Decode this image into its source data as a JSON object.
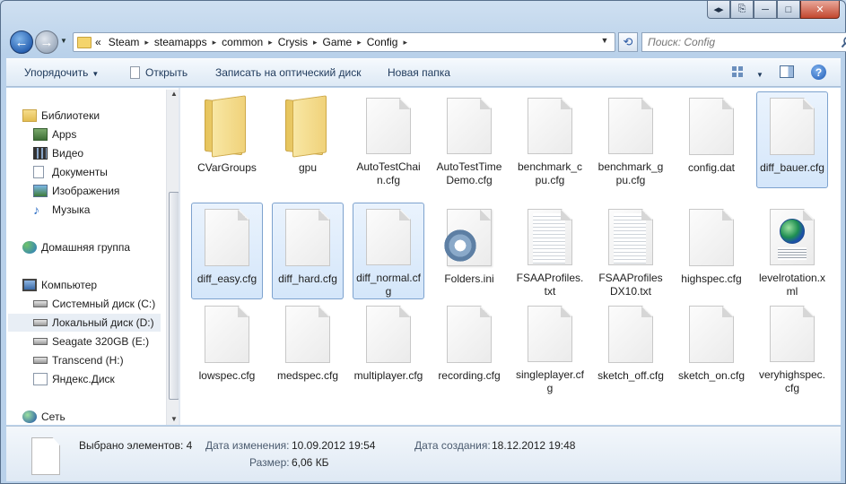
{
  "window": {
    "caption_buttons": [
      "◂▸",
      "⎘",
      "─",
      "□",
      "✕"
    ]
  },
  "nav": {
    "crumbs": [
      "Steam",
      "steamapps",
      "common",
      "Crysis",
      "Game",
      "Config"
    ],
    "overflow": "«",
    "search_placeholder": "Поиск: Config"
  },
  "toolbar": {
    "organize": "Упорядочить",
    "open": "Открыть",
    "burn": "Записать на оптический диск",
    "new_folder": "Новая папка"
  },
  "sidebar": {
    "libraries": "Библиотеки",
    "apps": "Apps",
    "video": "Видео",
    "documents": "Документы",
    "images": "Изображения",
    "music": "Музыка",
    "homegroup": "Домашняя группа",
    "computer": "Компьютер",
    "drive_c": "Системный диск (C:)",
    "drive_d": "Локальный диск (D:)",
    "drive_e": "Seagate 320GB (E:)",
    "drive_h": "Transcend (H:)",
    "yandex": "Яндекс.Диск",
    "network": "Сеть"
  },
  "files": [
    {
      "name": "CVarGroups",
      "type": "folder",
      "selected": false
    },
    {
      "name": "gpu",
      "type": "folder",
      "selected": false
    },
    {
      "name": "AutoTestChain.cfg",
      "type": "file",
      "selected": false
    },
    {
      "name": "AutoTestTimeDemo.cfg",
      "type": "file",
      "selected": false
    },
    {
      "name": "benchmark_cpu.cfg",
      "type": "file",
      "selected": false
    },
    {
      "name": "benchmark_gpu.cfg",
      "type": "file",
      "selected": false
    },
    {
      "name": "config.dat",
      "type": "file",
      "selected": false
    },
    {
      "name": "diff_bauer.cfg",
      "type": "file",
      "selected": true
    },
    {
      "name": "diff_easy.cfg",
      "type": "file",
      "selected": true
    },
    {
      "name": "diff_hard.cfg",
      "type": "file",
      "selected": true
    },
    {
      "name": "diff_normal.cfg",
      "type": "file",
      "selected": true
    },
    {
      "name": "Folders.ini",
      "type": "ini",
      "selected": false
    },
    {
      "name": "FSAAProfiles.txt",
      "type": "txt",
      "selected": false
    },
    {
      "name": "FSAAProfilesDX10.txt",
      "type": "txt",
      "selected": false
    },
    {
      "name": "highspec.cfg",
      "type": "file",
      "selected": false
    },
    {
      "name": "levelrotation.xml",
      "type": "xml",
      "selected": false
    },
    {
      "name": "lowspec.cfg",
      "type": "file",
      "selected": false
    },
    {
      "name": "medspec.cfg",
      "type": "file",
      "selected": false
    },
    {
      "name": "multiplayer.cfg",
      "type": "file",
      "selected": false
    },
    {
      "name": "recording.cfg",
      "type": "file",
      "selected": false
    },
    {
      "name": "singleplayer.cfg",
      "type": "file",
      "selected": false
    },
    {
      "name": "sketch_off.cfg",
      "type": "file",
      "selected": false
    },
    {
      "name": "sketch_on.cfg",
      "type": "file",
      "selected": false
    },
    {
      "name": "veryhighspec.cfg",
      "type": "file",
      "selected": false
    }
  ],
  "details": {
    "selected": "Выбрано элементов: 4",
    "modified_label": "Дата изменения:",
    "modified_value": "10.09.2012 19:54",
    "created_label": "Дата создания:",
    "created_value": "18.12.2012 19:48",
    "size_label": "Размер:",
    "size_value": "6,06 КБ"
  }
}
